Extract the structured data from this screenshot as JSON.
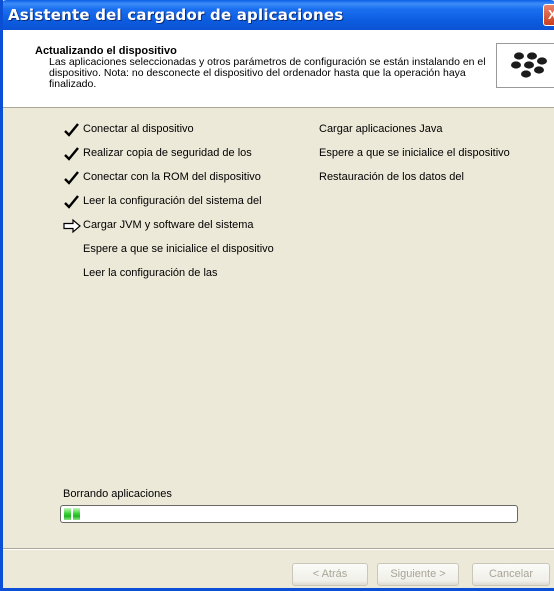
{
  "window": {
    "title": "Asistente del cargador de aplicaciones",
    "close_glyph": "X"
  },
  "header": {
    "title": "Actualizando el dispositivo",
    "description": "Las aplicaciones seleccionadas y otros parámetros de configuración se están instalando en el dispositivo. Nota: no desconecte el dispositivo del ordenador hasta que la operación haya finalizado.",
    "logo_icon": "blackberry-logo"
  },
  "steps_col1": [
    {
      "label": "Conectar al dispositivo",
      "status": "done"
    },
    {
      "label": "Realizar copia de seguridad de los",
      "status": "done"
    },
    {
      "label": "Conectar con la ROM del dispositivo",
      "status": "done"
    },
    {
      "label": "Leer la configuración del sistema del",
      "status": "done"
    },
    {
      "label": "Cargar JVM y software del sistema",
      "status": "current"
    },
    {
      "label": "Espere a que se inicialice el dispositivo",
      "status": "pending"
    },
    {
      "label": "Leer la configuración de las",
      "status": "pending"
    }
  ],
  "steps_col2": [
    {
      "label": "Cargar aplicaciones Java",
      "status": "pending"
    },
    {
      "label": "Espere a que se inicialice el dispositivo",
      "status": "pending"
    },
    {
      "label": "Restauración de los datos del",
      "status": "pending"
    }
  ],
  "progress": {
    "label": "Borrando aplicaciones",
    "fraction": 0.04,
    "accent": "#2fc42f"
  },
  "buttons": {
    "back": "< Atrás",
    "next": "Siguiente >",
    "cancel": "Cancelar"
  }
}
